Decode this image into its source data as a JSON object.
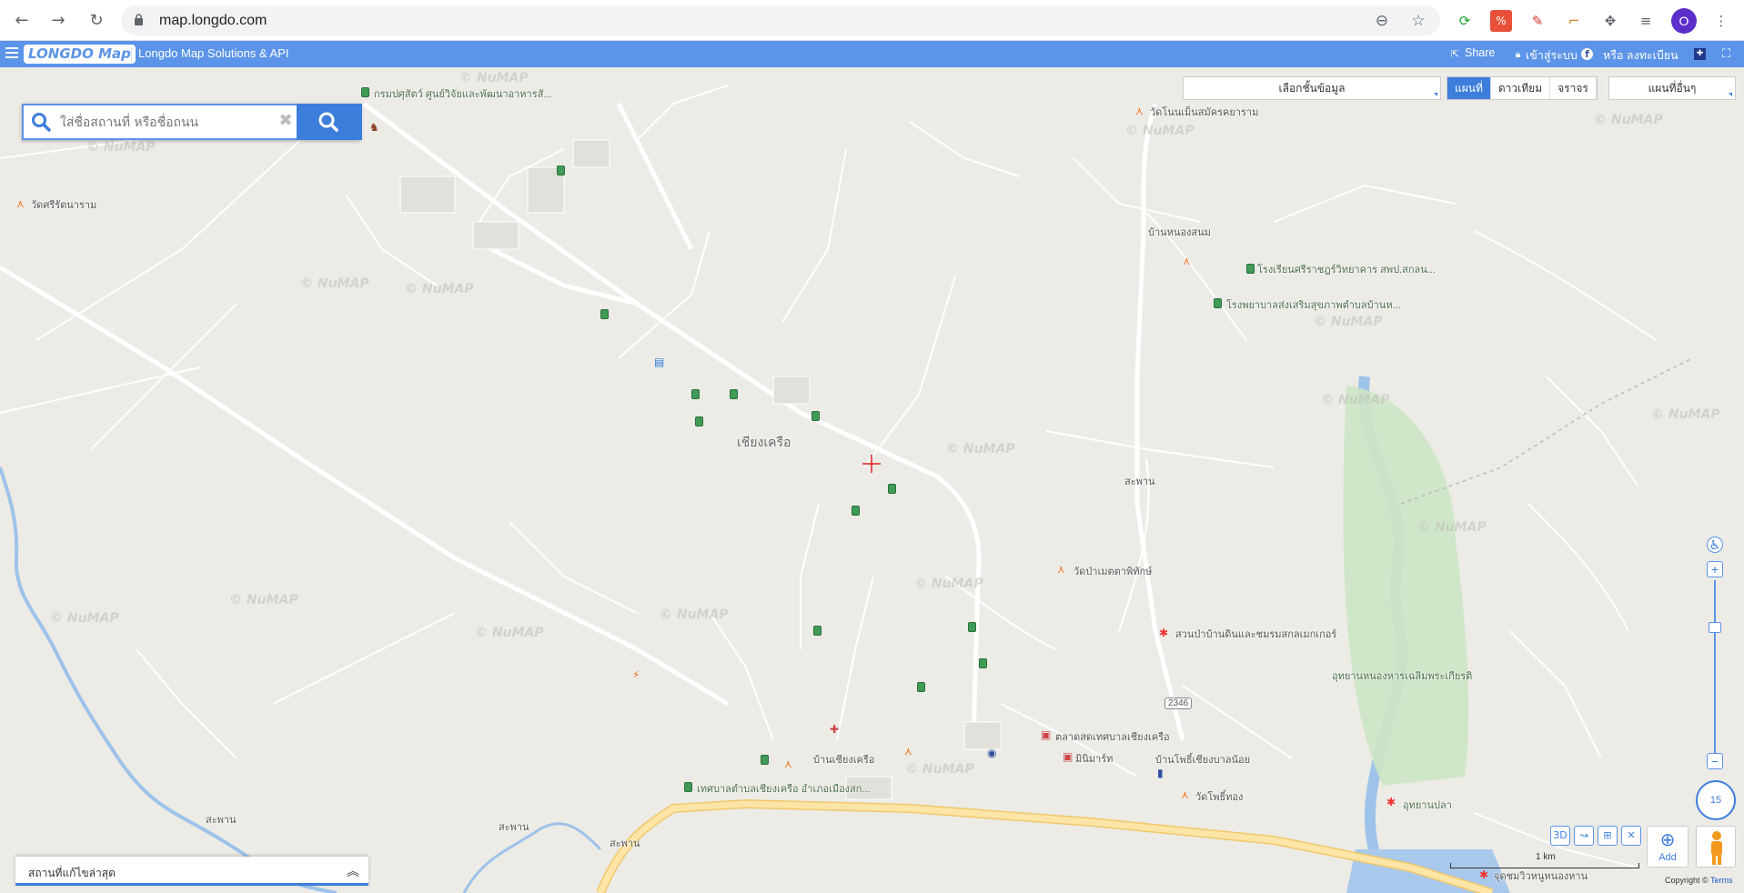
{
  "browser": {
    "url": "map.longdo.com",
    "profile_initial": "O"
  },
  "app": {
    "logo": "LONGDO Map",
    "title": "Longdo Map Solutions & API",
    "share": "Share",
    "login": "เข้าสู่ระบบ",
    "or_register": "หรือ ลงทะเบียน"
  },
  "search": {
    "placeholder": "ใส่ชื่อสถานที่ หรือชื่อถนน"
  },
  "layers": {
    "select_label": "เลือกชั้นข้อมูล",
    "tabs": [
      "แผนที่",
      "ดาวเทียม",
      "จราจร"
    ],
    "active_tab": "แผนที่",
    "other_maps": "แผนที่อื่นๆ"
  },
  "map": {
    "watermark": "© NuMAP",
    "places": {
      "p1": "กรมปศุสัตว์ ศูนย์วิจัยและพัฒนาอาหารสั...",
      "p2": "วัดศรีรัตนาราม",
      "p3": "เชียงเครือ",
      "p4": "บ้านหนองสนม",
      "p5": "โรงเรียนศรีราชฎร์วิทยาคาร สพป.สกลน...",
      "p6": "โรงพยาบาลส่งเสริมสุขภาพตำบลบ้านห...",
      "p7": "วัดโนนเม็นสมัครคยาราม",
      "p8": "สะพาน",
      "p9": "วัดป่าเมตตาพิทักษ์",
      "p10": "สวนป่าบ้านดินและชมรมสกลเมกเกอร์",
      "p11": "อุทยานหนองหารเฉลิมพระเกียรติ",
      "p12": "2346",
      "p13": "ตลาดสดเทศบาลเชียงเครือ",
      "p14": "มินิมาร์ท",
      "p15": "บ้านเชียงเครือ",
      "p16": "บ้านโพธิ์เชียงบาลน้อย",
      "p17": "เทศบาลตำบลเชียงเครือ อำเภอเมืองสก...",
      "p18": "วัดโพธิ์ทอง",
      "p19": "อุทยานปลา",
      "p20": "สะพาน",
      "p21": "สะพาน",
      "p22": "สะพาน",
      "p23": "จุดชมวิวหนูหนองหาน"
    }
  },
  "controls": {
    "zoom_level": "15",
    "tools": [
      "3D"
    ],
    "add_label": "Add",
    "scale_label": "1 km",
    "copyright": "Copyright ©",
    "terms": "Terms"
  },
  "recent": {
    "label": "สถานที่แก้ไขล่าสุด"
  },
  "colors": {
    "accent": "#5b94e8",
    "accent_dark": "#3d7edc",
    "highway": "#fce5a7",
    "water": "#a9c9ec",
    "park": "#cde5c4"
  }
}
